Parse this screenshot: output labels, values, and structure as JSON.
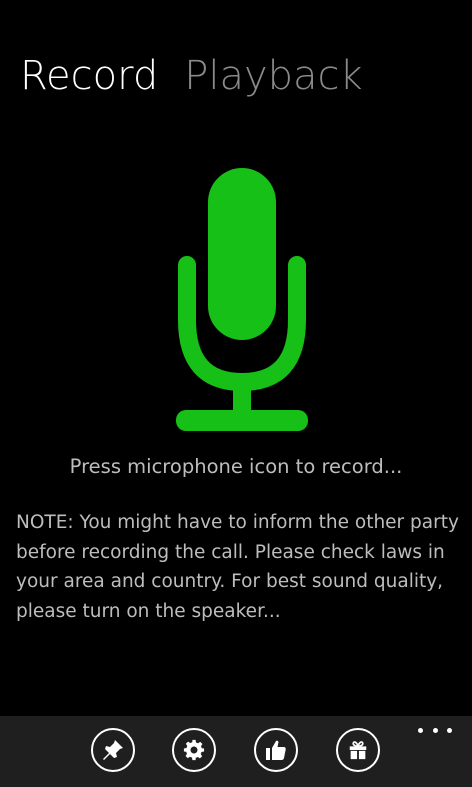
{
  "pivot": {
    "tabs": [
      {
        "label": "Record",
        "active": true
      },
      {
        "label": "Playback",
        "active": false
      }
    ]
  },
  "record": {
    "hint": "Press microphone icon to record...",
    "note": "NOTE: You might have to inform the other party before recording the call. Please check laws in your area and country. For best sound quality, please turn on the speaker..."
  },
  "app_bar": {
    "buttons": [
      {
        "icon": "pin-icon"
      },
      {
        "icon": "gear-icon"
      },
      {
        "icon": "thumbs-up-icon"
      },
      {
        "icon": "gift-icon"
      }
    ],
    "more_icon": "ellipsis-icon"
  },
  "colors": {
    "background": "#000000",
    "mic_green": "#16c016",
    "inactive_tab": "#8a8a8a",
    "body_text": "#bdbdbd",
    "app_bar": "#1f1f1f"
  }
}
